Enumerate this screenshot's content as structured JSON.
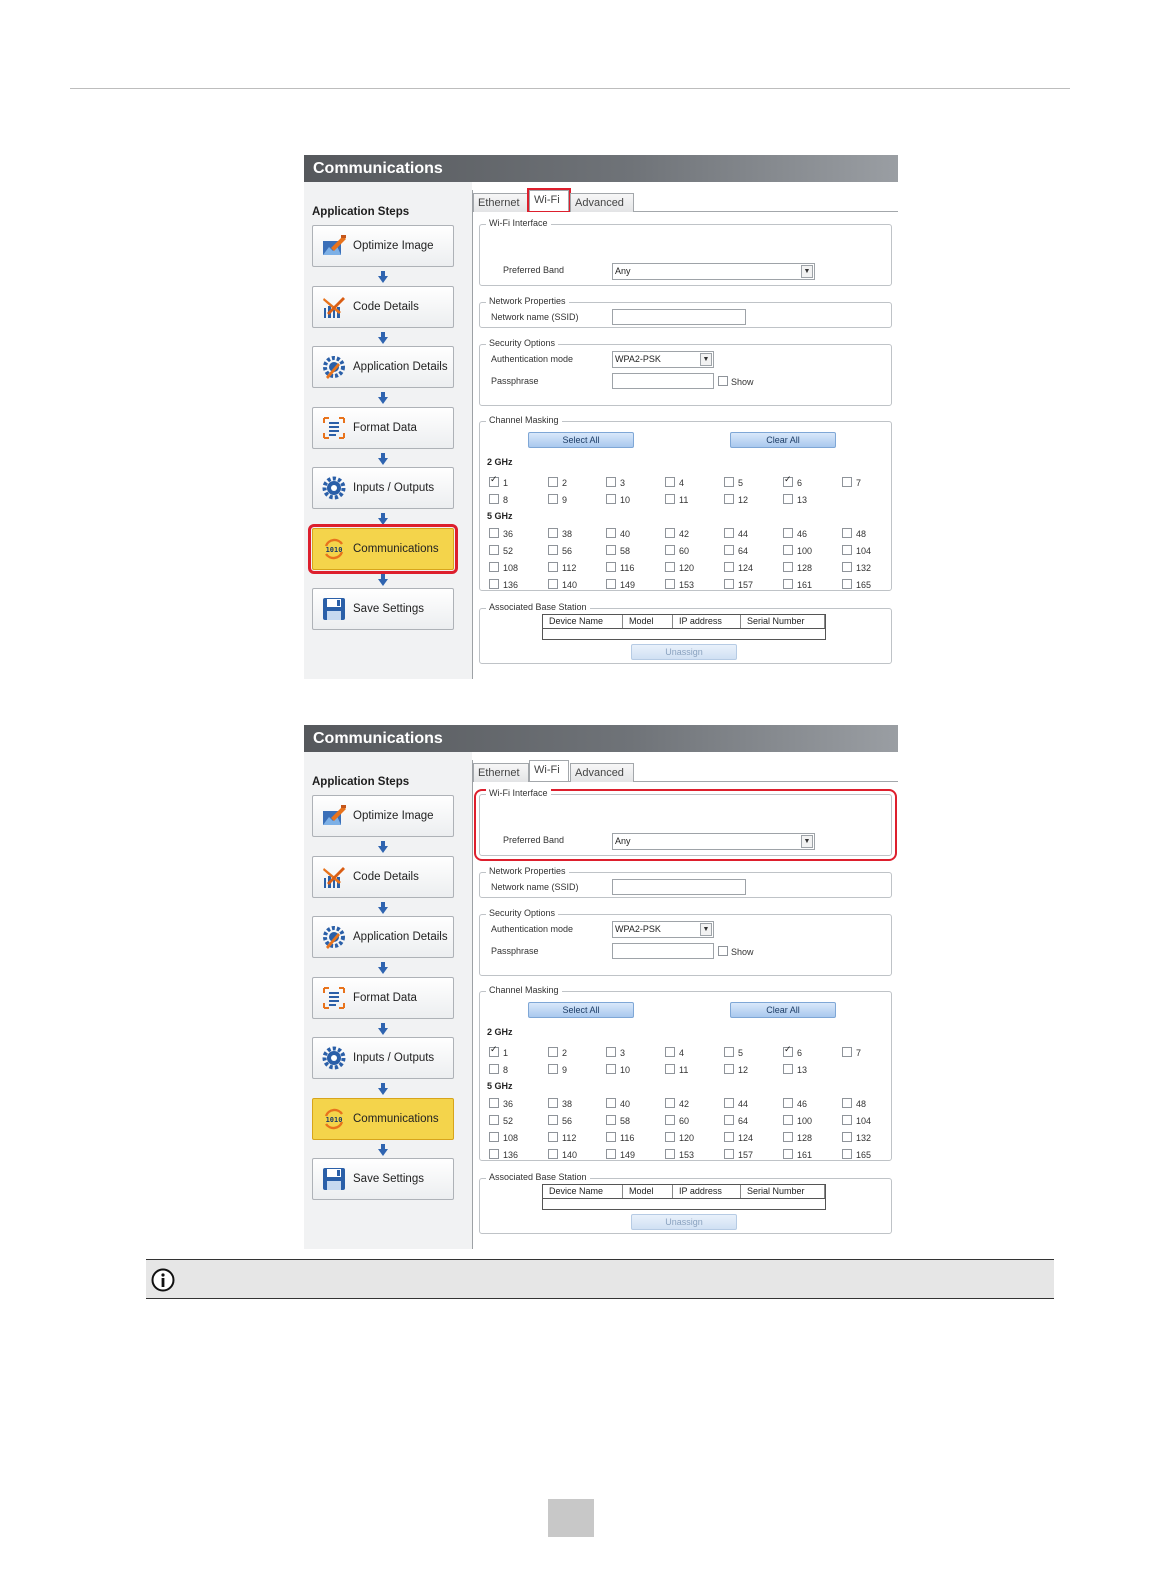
{
  "panel_title": "Communications",
  "steps_heading": "Application Steps",
  "steps": [
    {
      "label": "Optimize Image",
      "icon": "optimize-image-icon"
    },
    {
      "label": "Code Details",
      "icon": "code-details-icon"
    },
    {
      "label": "Application Details",
      "icon": "application-details-icon"
    },
    {
      "label": "Format Data",
      "icon": "format-data-icon"
    },
    {
      "label": "Inputs / Outputs",
      "icon": "inputs-outputs-gear-icon"
    },
    {
      "label": "Communications",
      "icon": "communications-icon"
    },
    {
      "label": "Save Settings",
      "icon": "save-floppy-icon"
    }
  ],
  "tabs": [
    "Ethernet",
    "Wi-Fi",
    "Advanced"
  ],
  "wifi_interface": {
    "legend": "Wi-Fi Interface",
    "preferred_band_label": "Preferred Band",
    "preferred_band_value": "Any"
  },
  "network_properties": {
    "legend": "Network Properties",
    "ssid_label": "Network name (SSID)",
    "ssid_value": ""
  },
  "security_options": {
    "legend": "Security Options",
    "auth_mode_label": "Authentication mode",
    "auth_mode_value": "WPA2-PSK",
    "passphrase_label": "Passphrase",
    "passphrase_value": "",
    "show_label": "Show"
  },
  "channel_masking": {
    "legend": "Channel Masking",
    "select_all": "Select All",
    "clear_all": "Clear All",
    "band_24_label": "2 GHz",
    "band_5_label": "5 GHz",
    "channels_24": [
      {
        "n": "1",
        "checked": true
      },
      {
        "n": "2",
        "checked": false
      },
      {
        "n": "3",
        "checked": false
      },
      {
        "n": "4",
        "checked": false
      },
      {
        "n": "5",
        "checked": false
      },
      {
        "n": "6",
        "checked": true
      },
      {
        "n": "7",
        "checked": false
      },
      {
        "n": "8",
        "checked": false
      },
      {
        "n": "9",
        "checked": false
      },
      {
        "n": "10",
        "checked": false
      },
      {
        "n": "11",
        "checked": false
      },
      {
        "n": "12",
        "checked": false
      },
      {
        "n": "13",
        "checked": false
      }
    ],
    "channels_5": [
      "36",
      "38",
      "40",
      "42",
      "44",
      "46",
      "48",
      "52",
      "56",
      "58",
      "60",
      "64",
      "100",
      "104",
      "108",
      "112",
      "116",
      "120",
      "124",
      "128",
      "132",
      "136",
      "140",
      "149",
      "153",
      "157",
      "161",
      "165"
    ]
  },
  "base_station": {
    "legend": "Associated Base Station",
    "columns": [
      "Device Name",
      "Model",
      "IP address",
      "Serial Number"
    ],
    "unassign": "Unassign"
  },
  "colors": {
    "highlight_red": "#dd1f2d",
    "active_step_yellow": "#f4d44b",
    "button_blue": "#a9c8ee"
  }
}
